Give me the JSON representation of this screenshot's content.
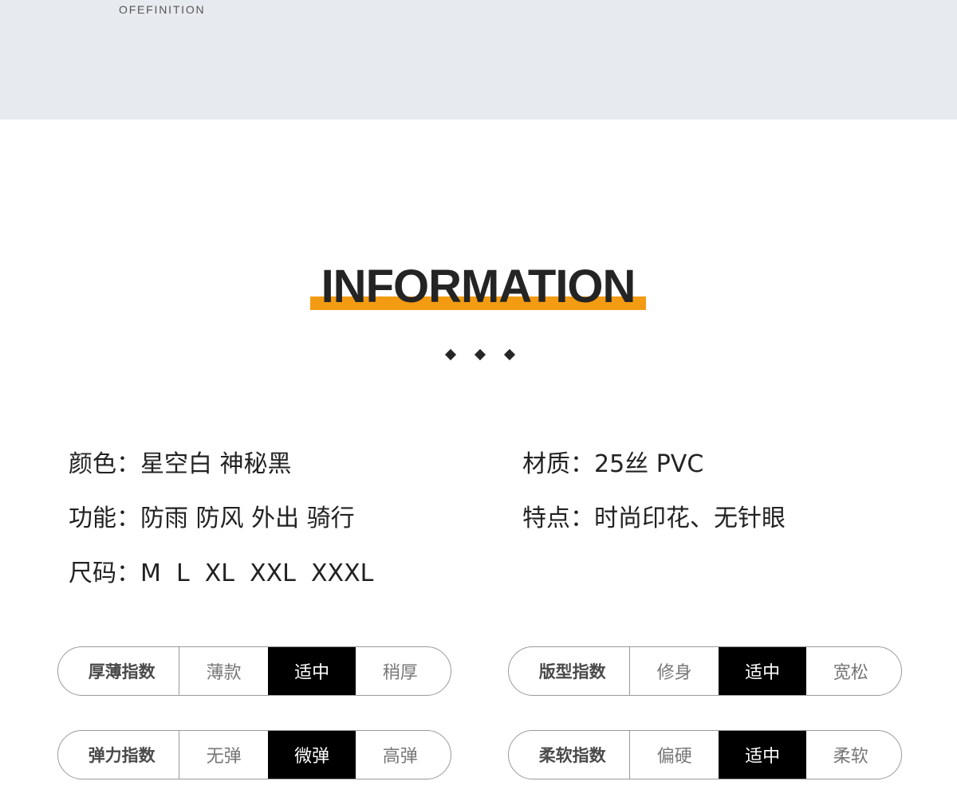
{
  "banner": {
    "subtitle": "OFEFINITION"
  },
  "heading": {
    "title": "INFORMATION",
    "accent_color": "#f39b12"
  },
  "specs": {
    "color": "颜色：星空白 神秘黑",
    "function": "功能：防雨 防风 外出 骑行",
    "size": "尺码：M  L  XL  XXL  XXXL",
    "material": "材质：25丝 PVC",
    "feature": "特点：时尚印花、无针眼"
  },
  "ratings": [
    {
      "label": "厚薄指数",
      "options": [
        "薄款",
        "适中",
        "稍厚"
      ],
      "selected": "适中"
    },
    {
      "label": "版型指数",
      "options": [
        "修身",
        "适中",
        "宽松"
      ],
      "selected": "适中"
    },
    {
      "label": "弹力指数",
      "options": [
        "无弹",
        "微弹",
        "高弹"
      ],
      "selected": "微弹"
    },
    {
      "label": "柔软指数",
      "options": [
        "偏硬",
        "适中",
        "柔软"
      ],
      "selected": "适中"
    }
  ]
}
